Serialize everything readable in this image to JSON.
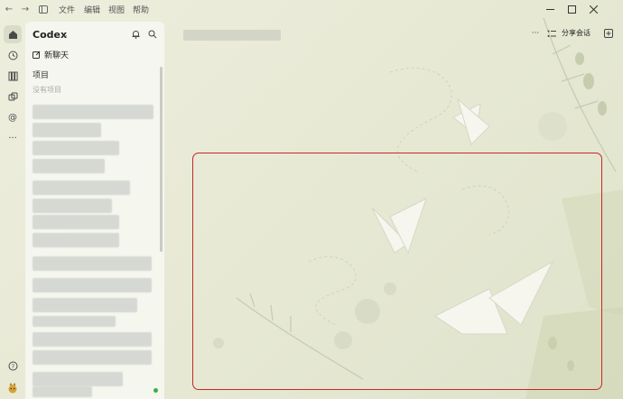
{
  "titlebar": {
    "menus": [
      "文件",
      "编辑",
      "视图",
      "帮助"
    ]
  },
  "rail": {
    "icons": [
      "home-icon",
      "history-icon",
      "library-icon",
      "plugins-icon",
      "mention-icon",
      "more-icon",
      "help-icon",
      "avatar"
    ]
  },
  "sidebar": {
    "title": "Codex",
    "new_chat_label": "新聊天",
    "section_label": "项目",
    "empty_label": "没有项目"
  },
  "header": {
    "share_label": "分享会话"
  },
  "colors": {
    "highlight": "#c62828",
    "online": "#36b04a",
    "background": "#e9ead8"
  }
}
